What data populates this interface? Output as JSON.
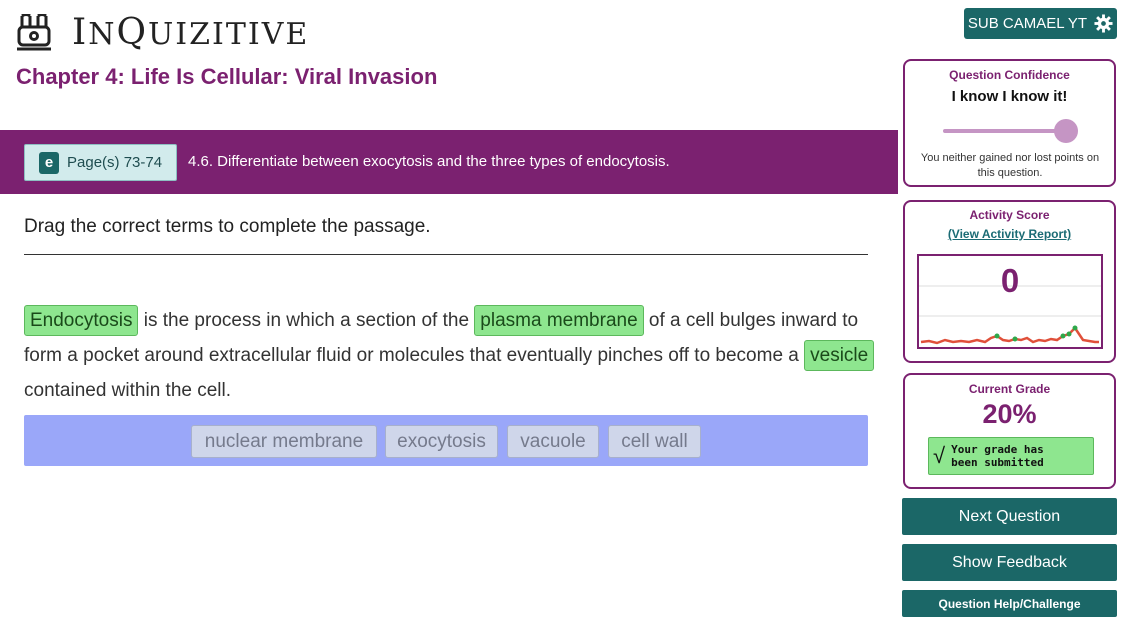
{
  "app": {
    "logo_text": "INQUIZITIVE",
    "user_label": "SUB CAMAEL YT"
  },
  "chapter": {
    "title": "Chapter 4: Life Is Cellular: Viral Invasion"
  },
  "band": {
    "page_button": "Page(s) 73-74",
    "ebook_glyph": "e",
    "objective": "4.6. Differentiate between exocytosis and the three types of endocytosis."
  },
  "question": {
    "prompt": "Drag the correct terms to complete the passage.",
    "passage": {
      "chip_1": "Endocytosis",
      "text_1": " is the process in which a section of the ",
      "chip_2": "plasma membrane",
      "text_2": " of a cell bulges inward to",
      "text_3": "form a pocket around extracellular fluid or molecules that eventually pinches off to become a ",
      "chip_3": "vesicle",
      "text_4": "contained within the cell."
    },
    "word_bank": [
      "nuclear membrane",
      "exocytosis",
      "vacuole",
      "cell wall"
    ]
  },
  "sidebar": {
    "confidence": {
      "label": "Question Confidence",
      "value": "I know I know it!",
      "level": 1.0,
      "note": "You neither gained nor lost points on this question."
    },
    "activity": {
      "label": "Activity Score",
      "link": "(View Activity Report)",
      "score": "0"
    },
    "grade": {
      "label": "Current Grade",
      "value": "20%",
      "status_line1": "Your grade has",
      "status_line2": "been submitted"
    },
    "buttons": {
      "next": "Next Question",
      "feedback": "Show Feedback",
      "help": "Question Help/Challenge"
    }
  },
  "colors": {
    "brand_purple": "#7b2170",
    "teal": "#1b6767",
    "chip_green": "#8ee68f",
    "bank_blue": "#9aa7f9"
  },
  "icons": {
    "logo": "bunny-logo-icon",
    "settings": "gear-icon",
    "ebook": "ebook-icon",
    "check": "check-icon"
  }
}
